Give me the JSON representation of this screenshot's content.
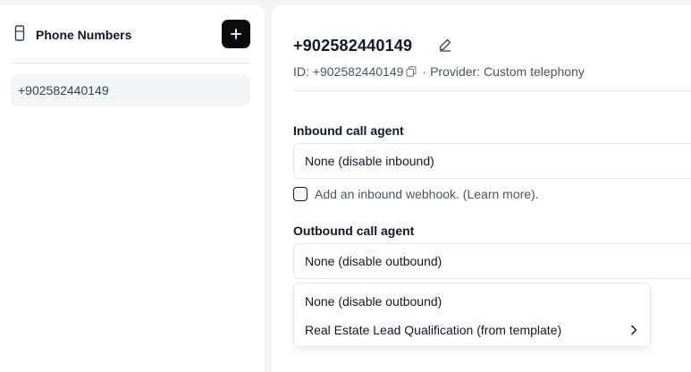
{
  "sidebar": {
    "title": "Phone Numbers",
    "add_button_icon": "plus-icon",
    "items": [
      {
        "label": "+902582440149",
        "selected": true
      }
    ]
  },
  "main": {
    "title": "+902582440149",
    "meta": {
      "id_text": "ID: +902582440149",
      "separator": "·",
      "provider_text": "Provider: Custom telephony"
    },
    "inbound": {
      "label": "Inbound call agent",
      "value": "None (disable inbound)",
      "webhook_checkbox_label": "Add an inbound webhook. (Learn more).",
      "webhook_checked": false
    },
    "outbound": {
      "label": "Outbound call agent",
      "value": "None (disable outbound)",
      "options": [
        {
          "label": "None (disable outbound)",
          "has_submenu": false
        },
        {
          "label": "Real Estate Lead Qualification (from template)",
          "has_submenu": true
        }
      ]
    }
  },
  "colors": {
    "accent_button": "#0b0b0f",
    "page_background": "#f3f4f6",
    "selected_item_background": "#f3f4f6"
  }
}
